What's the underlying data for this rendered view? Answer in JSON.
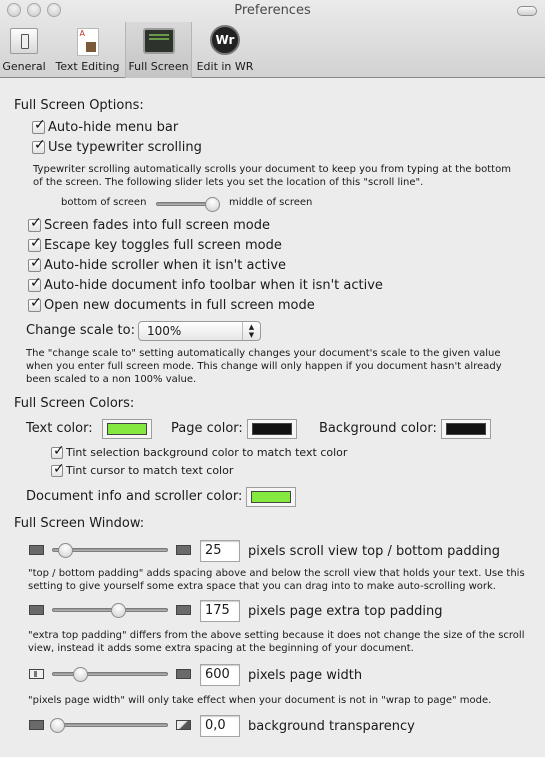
{
  "window": {
    "title": "Preferences"
  },
  "toolbar": {
    "items": [
      {
        "label": "General",
        "icon": "general-switch-icon",
        "selected": false
      },
      {
        "label": "Text Editing",
        "icon": "text-document-icon",
        "selected": false
      },
      {
        "label": "Full Screen",
        "icon": "monitor-icon",
        "selected": true
      },
      {
        "label": "Edit in WR",
        "icon": "wr-logo-icon",
        "selected": false
      }
    ],
    "wr_glyph": "Wr"
  },
  "options": {
    "heading": "Full Screen Options:",
    "auto_hide_menu_bar": {
      "label": "Auto-hide menu bar",
      "checked": true
    },
    "typewriter_scrolling": {
      "label": "Use typewriter scrolling",
      "checked": true
    },
    "typewriter_help": "Typewriter scrolling automatically scrolls your document to keep you from typing at the bottom of the screen. The following slider lets you set the location of this \"scroll line\".",
    "scroll_line_slider": {
      "min_label": "bottom of screen",
      "max_label": "middle of screen",
      "value_fraction": 1.0
    },
    "checkboxes": [
      {
        "label": "Screen fades into full screen mode",
        "checked": true
      },
      {
        "label": "Escape key toggles full screen mode",
        "checked": true
      },
      {
        "label": "Auto-hide scroller when it isn't active",
        "checked": true
      },
      {
        "label": "Auto-hide document info toolbar when it isn't active",
        "checked": true
      },
      {
        "label": "Open new documents in full screen mode",
        "checked": true
      }
    ],
    "change_scale": {
      "label": "Change scale to:",
      "value": "100%"
    },
    "change_scale_help": "The \"change scale to\" setting automatically changes your document's scale to the given value when you enter full screen mode. This change will only happen if you document hasn't already been scaled to a non 100% value."
  },
  "colors": {
    "heading": "Full Screen Colors:",
    "text_color": {
      "label": "Text color:",
      "value": "#85e83e"
    },
    "page_color": {
      "label": "Page color:",
      "value": "#121212"
    },
    "background_color": {
      "label": "Background color:",
      "value": "#121212"
    },
    "tint_selection": {
      "label": "Tint selection background color to match text color",
      "checked": true
    },
    "tint_cursor": {
      "label": "Tint cursor to match text color",
      "checked": true
    },
    "doc_info_color": {
      "label": "Document info and scroller color:",
      "value": "#85e83e"
    }
  },
  "window_settings": {
    "heading": "Full Screen Window:",
    "scroll_padding": {
      "value": "25",
      "label": "pixels scroll view top / bottom padding",
      "slider_fraction": 0.08
    },
    "scroll_padding_help": "\"top / bottom padding\" adds spacing above and below the scroll view that holds your text. Use this setting to give yourself some extra space that you can drag into to make auto-scrolling work.",
    "top_padding": {
      "value": "175",
      "label": "pixels page extra top padding",
      "slider_fraction": 0.58
    },
    "top_padding_help": "\"extra top padding\" differs from the above setting because it does not change the size of the scroll view, instead it adds some extra spacing at the beginning of your document.",
    "page_width": {
      "value": "600",
      "label": "pixels page width",
      "slider_fraction": 0.22
    },
    "page_width_help": "\"pixels page width\" will only take effect when your document is not in \"wrap to page\" mode.",
    "transparency": {
      "value": "0,0",
      "label": "background transparency",
      "slider_fraction": 0.0
    }
  }
}
